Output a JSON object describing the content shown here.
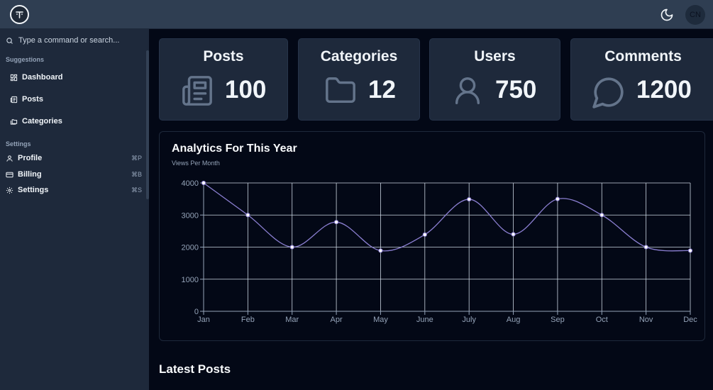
{
  "header": {
    "logo_icon": "brand-logo-icon",
    "theme_icon": "moon-icon",
    "avatar_initials": "CN"
  },
  "sidebar": {
    "search_placeholder": "Type a command or search...",
    "suggestions_title": "Suggestions",
    "suggestions": [
      {
        "label": "Dashboard",
        "icon": "dashboard-icon"
      },
      {
        "label": "Posts",
        "icon": "newspaper-icon"
      },
      {
        "label": "Categories",
        "icon": "folders-icon"
      }
    ],
    "settings_title": "Settings",
    "settings": [
      {
        "label": "Profile",
        "icon": "user-icon",
        "shortcut": "⌘P"
      },
      {
        "label": "Billing",
        "icon": "credit-card-icon",
        "shortcut": "⌘B"
      },
      {
        "label": "Settings",
        "icon": "gear-icon",
        "shortcut": "⌘S"
      }
    ]
  },
  "stats": [
    {
      "label": "Posts",
      "value": "100",
      "icon": "newspaper-icon"
    },
    {
      "label": "Categories",
      "value": "12",
      "icon": "folder-icon"
    },
    {
      "label": "Users",
      "value": "750",
      "icon": "user-icon"
    },
    {
      "label": "Comments",
      "value": "1200",
      "icon": "message-circle-icon"
    }
  ],
  "chart": {
    "title": "Analytics For This Year",
    "subtitle": "Views Per Month"
  },
  "chart_data": {
    "type": "line",
    "title": "Analytics For This Year",
    "subtitle": "Views Per Month",
    "categories": [
      "Jan",
      "Feb",
      "Mar",
      "Apr",
      "May",
      "June",
      "July",
      "Aug",
      "Sep",
      "Oct",
      "Nov",
      "Dec"
    ],
    "series": [
      {
        "values": [
          4000,
          3000,
          2000,
          2780,
          1890,
          2390,
          3490,
          2400,
          3500,
          3000,
          2000,
          1890
        ]
      }
    ],
    "yticks": [
      0,
      1000,
      2000,
      3000,
      4000
    ],
    "ylim": [
      0,
      4000
    ],
    "grid": true,
    "line_color": "#8b7fd1"
  },
  "latest": {
    "title": "Latest Posts"
  },
  "colors": {
    "topbar": "#2f3e52",
    "sidebar": "#1e293b",
    "background": "#030816",
    "card": "#1e293b"
  }
}
